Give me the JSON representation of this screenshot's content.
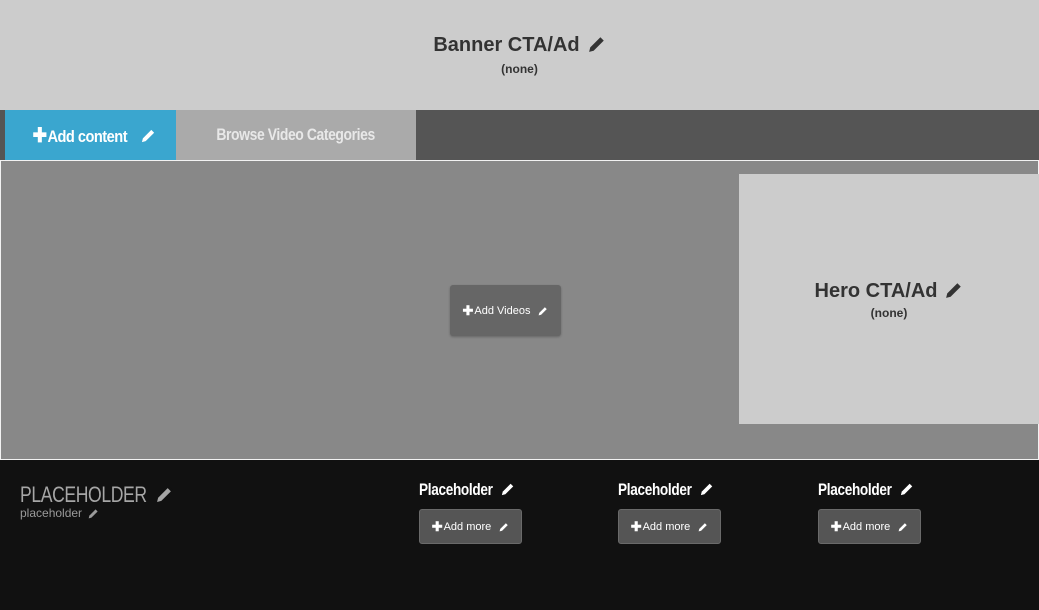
{
  "banner": {
    "title": "Banner CTA/Ad",
    "subtitle": "(none)"
  },
  "nav": {
    "add_content_label": "Add content",
    "browse_label": "Browse Video Categories"
  },
  "hero": {
    "add_videos_label": "Add Videos",
    "cta_title": "Hero CTA/Ad",
    "cta_subtitle": "(none)"
  },
  "footer": {
    "main_title": "PLACEHOLDER",
    "main_subtitle": "placeholder",
    "columns": [
      {
        "title": "Placeholder",
        "button_label": "Add more"
      },
      {
        "title": "Placeholder",
        "button_label": "Add more"
      },
      {
        "title": "Placeholder",
        "button_label": "Add more"
      }
    ]
  },
  "colors": {
    "accent": "#3aa6cf",
    "banner_bg": "#cccccc",
    "nav_bg": "#555555",
    "hero_bg": "#888888",
    "footer_bg": "#111111"
  },
  "icons": [
    "pencil-icon",
    "plus-icon"
  ]
}
